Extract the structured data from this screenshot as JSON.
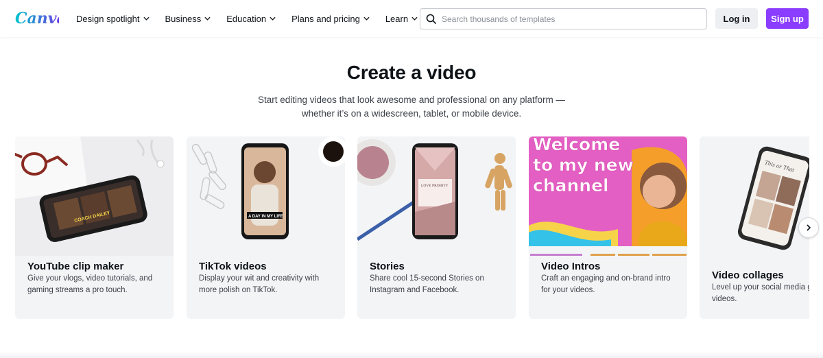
{
  "header": {
    "logo_text": "Canva",
    "nav": [
      {
        "label": "Design spotlight"
      },
      {
        "label": "Business"
      },
      {
        "label": "Education"
      },
      {
        "label": "Plans and pricing"
      },
      {
        "label": "Learn"
      }
    ],
    "search": {
      "placeholder": "Search thousands of templates",
      "value": ""
    },
    "login_label": "Log in",
    "signup_label": "Sign up"
  },
  "hero": {
    "title": "Create a video",
    "subtitle": "Start editing videos that look awesome and professional on any platform — whether it’s on a widescreen, tablet, or mobile device."
  },
  "cards": [
    {
      "title": "YouTube clip maker",
      "description": "Give your vlogs, video tutorials, and gaming streams a pro touch.",
      "thumb_text": "COACH DAILEY"
    },
    {
      "title": "TikTok videos",
      "description": "Display your wit and creativity with more polish on TikTok.",
      "thumb_text": "A DAY IN MY LIFE"
    },
    {
      "title": "Stories",
      "description": "Share cool 15-second Stories on Instagram and Facebook.",
      "thumb_text": "LOVE PROBITY"
    },
    {
      "title": "Video Intros",
      "description": "Craft an engaging and on-brand intro for your videos.",
      "thumb_text": "Welcome to my new channel"
    },
    {
      "title": "Video collages",
      "description": "Level up your social media game with artistic videos.",
      "thumb_text": "This or That"
    }
  ],
  "colors": {
    "brand_purple": "#8b3dff",
    "logo_gradient_start": "#00c4cc",
    "logo_gradient_end": "#7d2ae8",
    "card_bg": "#f3f4f6",
    "intro_pink": "#e45fc3"
  },
  "icons": [
    "search-icon",
    "chevron-down-icon",
    "chevron-right-icon"
  ]
}
